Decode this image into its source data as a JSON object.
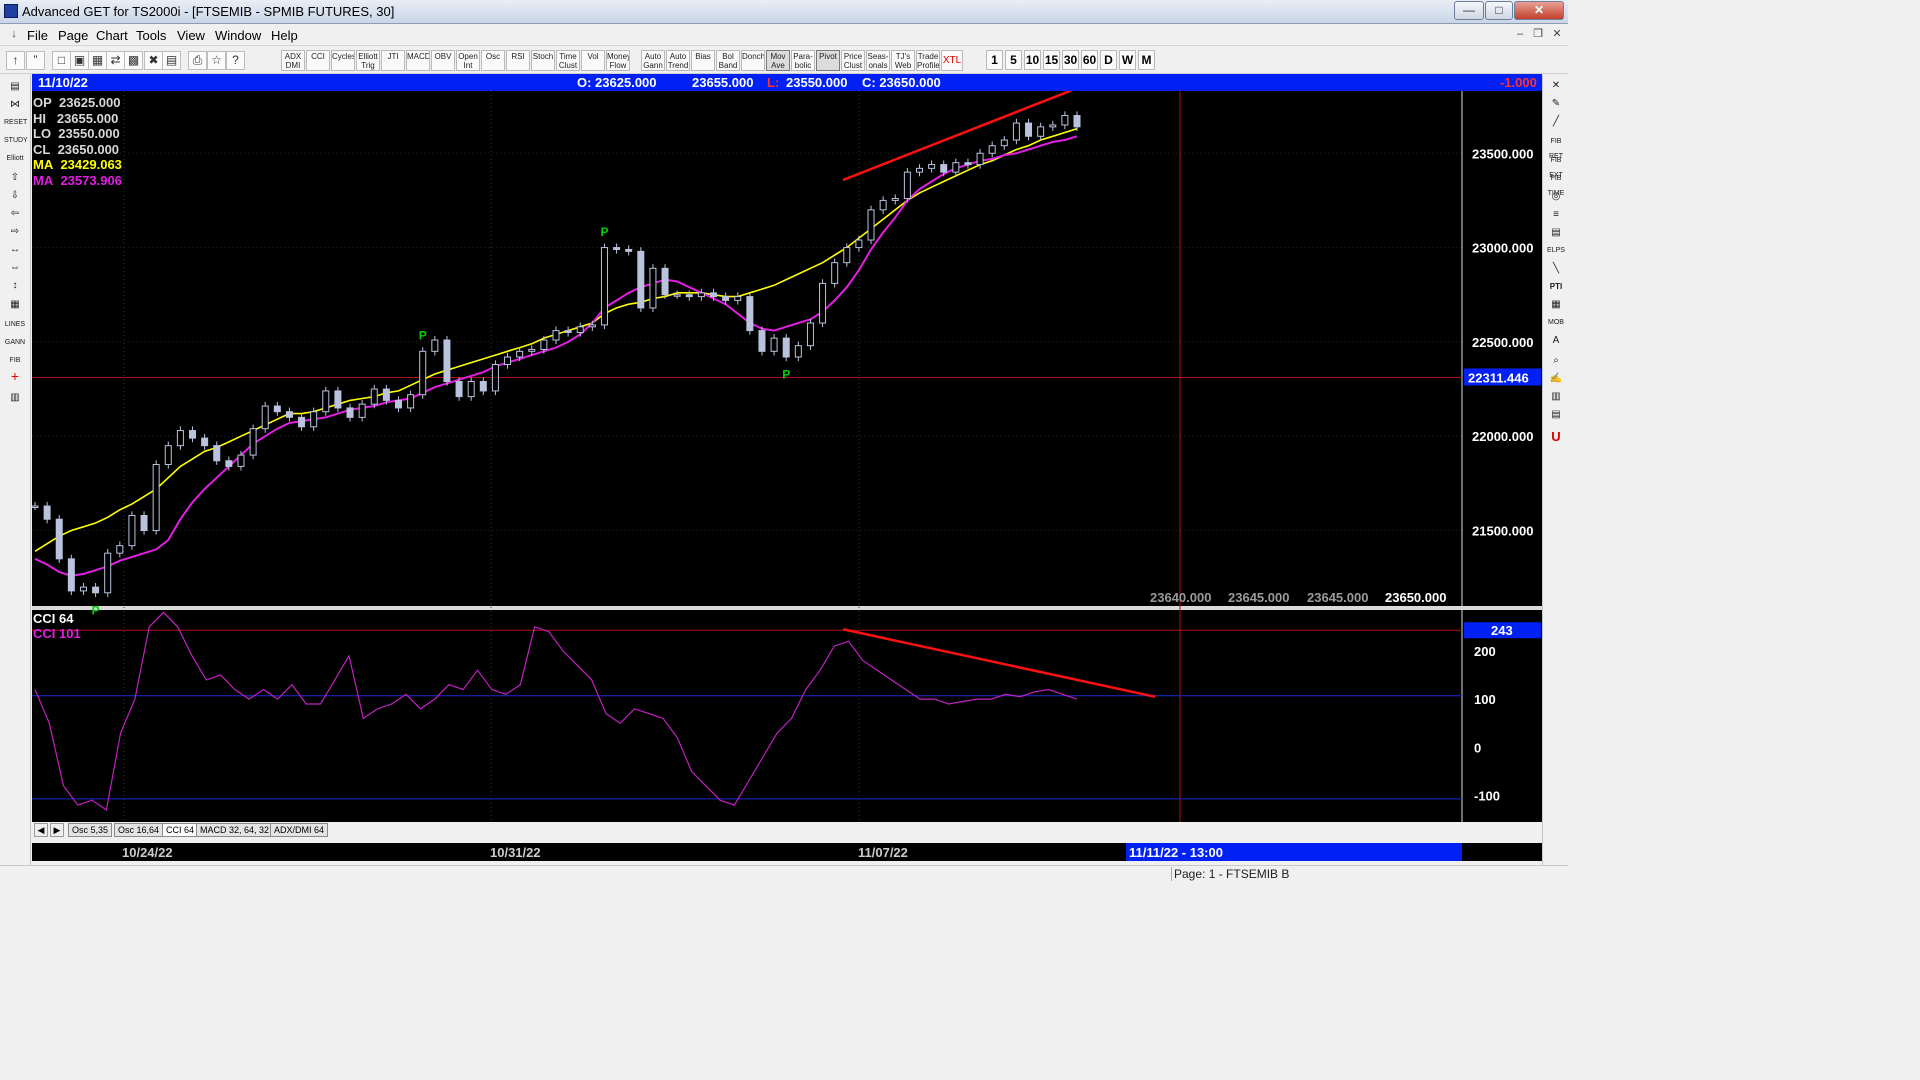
{
  "window": {
    "title": "Advanced GET for TS2000i - [FTSEMIB - SPMIB FUTURES, 30]",
    "minimize": "—",
    "maximize": "□",
    "close": "✕"
  },
  "menu": {
    "items": [
      "File",
      "Page",
      "Chart",
      "Tools",
      "View",
      "Window",
      "Help"
    ]
  },
  "toolbar": {
    "studies": [
      "ADX DMI",
      "CCI",
      "Cycles",
      "Elliott Trig",
      "JTI",
      "MACD",
      "OBV",
      "Open Int",
      "Osc",
      "RSI",
      "Stoch",
      "Time Clust",
      "Vol",
      "Money Flow",
      "Auto Gann",
      "Auto Trend",
      "Bias",
      "Bol Band",
      "Donch",
      "Mov Ave",
      "Para-bolic",
      "Pivot",
      "Price Clust",
      "Seas-onals",
      "TJ's Web",
      "Trade Profile",
      "XTL"
    ],
    "selected_studies": [
      "Mov Ave",
      "Pivot"
    ],
    "timeframes": [
      "1",
      "5",
      "10",
      "15",
      "30",
      "60",
      "D",
      "W",
      "M"
    ],
    "selected_timeframe": "30"
  },
  "info_bar": {
    "date": "11/10/22",
    "open": "O: 23625.000",
    "high": "23655.000",
    "low_label": "L:",
    "low": "23550.000",
    "close": "C: 23650.000",
    "change": "-1.000"
  },
  "legend": {
    "op_label": "OP",
    "op": "23625.000",
    "hi_label": "HI",
    "hi": "23655.000",
    "lo_label": "LO",
    "lo": "23550.000",
    "cl_label": "CL",
    "cl": "23650.000",
    "ma1_label": "MA",
    "ma1": "23429.063",
    "ma2_label": "MA",
    "ma2": "23573.906"
  },
  "price_axis": {
    "ticks": [
      "23500.000",
      "23000.000",
      "22500.000",
      "22000.000",
      "21500.000"
    ],
    "cursor_value": "22311.446"
  },
  "corner_values": [
    "23640.000",
    "23645.000",
    "23645.000",
    "23650.000"
  ],
  "pivot_label": "P",
  "cci_panel": {
    "title": "CCI 64",
    "subtitle": "CCI  101",
    "current_value": "243",
    "ticks": [
      "200",
      "100",
      "0",
      "-100"
    ]
  },
  "tabs": [
    "Osc 5,35",
    "Osc 16,64",
    "CCI 64",
    "MACD 32, 64, 32",
    "ADX/DMI 64"
  ],
  "selected_tab": "CCI 64",
  "dates": [
    "10/24/22",
    "10/31/22",
    "11/07/22"
  ],
  "cursor_date": "11/11/22 - 13:00",
  "status": "Page: 1 - FTSEMIB B",
  "colors": {
    "info_bar": "#0020f4",
    "candle": "#b9c3de",
    "ma_fast": "#ffff00",
    "ma_slow": "#e21ee2",
    "trendline": "#ff1010",
    "pivot": "#00d000",
    "cci": "#c020c0"
  },
  "chart_data": {
    "type": "line",
    "title": "FTSEMIB - SPMIB FUTURES, 30",
    "xlabel": "",
    "ylabel": "",
    "ylim": [
      21100,
      23830
    ],
    "x_date_labels": [
      "10/24/22",
      "10/31/22",
      "11/07/22"
    ],
    "series": [
      {
        "name": "",
        "values": [
          21630,
          21560,
          21350,
          21180,
          21200,
          21170,
          21380,
          21420,
          21580,
          21500,
          21850,
          21950,
          22030,
          21990,
          21950,
          21870,
          21840,
          21900,
          22040,
          22160,
          22130,
          22100,
          22050,
          22130,
          22240,
          22150,
          22100,
          22170,
          22250,
          22190,
          22150,
          22220,
          22450,
          22510,
          22290,
          22210,
          22290,
          22240,
          22380,
          22420,
          22450,
          22460,
          22510,
          22560,
          22550,
          22580,
          22590,
          23000,
          22990,
          22980,
          22680,
          22890,
          22750,
          22750,
          22740,
          22760,
          22740,
          22720,
          22740,
          22560,
          22450,
          22520,
          22420,
          22480,
          22600,
          22810,
          22920,
          23000,
          23040,
          23200,
          23250,
          23260,
          23400,
          23420,
          23440,
          23400,
          23450,
          23440,
          23500,
          23540,
          23570,
          23660,
          23590,
          23640,
          23650,
          23700,
          23640
        ]
      },
      {
        "name": "",
        "values": [
          21390,
          21430,
          21470,
          21500,
          21520,
          21540,
          21570,
          21610,
          21640,
          21680,
          21720,
          21780,
          21840,
          21880,
          21920,
          21940,
          21970,
          22000,
          22030,
          22060,
          22090,
          22120,
          22120,
          22130,
          22150,
          22170,
          22190,
          22200,
          22210,
          22230,
          22240,
          22270,
          22300,
          22330,
          22350,
          22370,
          22390,
          22410,
          22430,
          22450,
          22470,
          22490,
          22520,
          22540,
          22560,
          22580,
          22600,
          22650,
          22680,
          22700,
          22710,
          22730,
          22740,
          22760,
          22760,
          22760,
          22750,
          22740,
          22740,
          22760,
          22780,
          22800,
          22830,
          22860,
          22890,
          22920,
          22960,
          23000,
          23050,
          23100,
          23150,
          23200,
          23250,
          23290,
          23320,
          23350,
          23380,
          23410,
          23440,
          23460,
          23490,
          23520,
          23540,
          23570,
          23590,
          23610,
          23630
        ]
      },
      {
        "name": "",
        "values": [
          21350,
          21320,
          21280,
          21260,
          21270,
          21290,
          21310,
          21340,
          21360,
          21380,
          21400,
          21450,
          21560,
          21650,
          21720,
          21780,
          21840,
          21900,
          21960,
          22000,
          22040,
          22070,
          22080,
          22090,
          22100,
          22120,
          22140,
          22150,
          22160,
          22180,
          22190,
          22200,
          22230,
          22260,
          22280,
          22300,
          22320,
          22340,
          22370,
          22390,
          22410,
          22430,
          22450,
          22470,
          22500,
          22540,
          22600,
          22680,
          22720,
          22760,
          22790,
          22810,
          22830,
          22820,
          22790,
          22760,
          22730,
          22700,
          22650,
          22600,
          22570,
          22560,
          22580,
          22600,
          22620,
          22660,
          22720,
          22790,
          22880,
          22990,
          23080,
          23160,
          23250,
          23310,
          23350,
          23390,
          23420,
          23440,
          23460,
          23470,
          23490,
          23500,
          23520,
          23540,
          23560,
          23570,
          23590
        ]
      }
    ],
    "panel_cci": {
      "ylim": [
        -155,
        285
      ],
      "levels": [
        243,
        107,
        -107
      ],
      "values": [
        120,
        50,
        -80,
        -120,
        -110,
        -130,
        30,
        100,
        250,
        280,
        250,
        190,
        140,
        150,
        120,
        100,
        120,
        100,
        130,
        90,
        90,
        140,
        190,
        60,
        80,
        90,
        110,
        80,
        100,
        130,
        120,
        160,
        120,
        110,
        130,
        250,
        240,
        200,
        170,
        140,
        70,
        50,
        80,
        70,
        60,
        20,
        -50,
        -80,
        -110,
        -120,
        -70,
        -20,
        30,
        60,
        120,
        160,
        210,
        220,
        180,
        160,
        140,
        120,
        100,
        100,
        90,
        95,
        100,
        100,
        110,
        105,
        115,
        120,
        110,
        100
      ]
    }
  }
}
